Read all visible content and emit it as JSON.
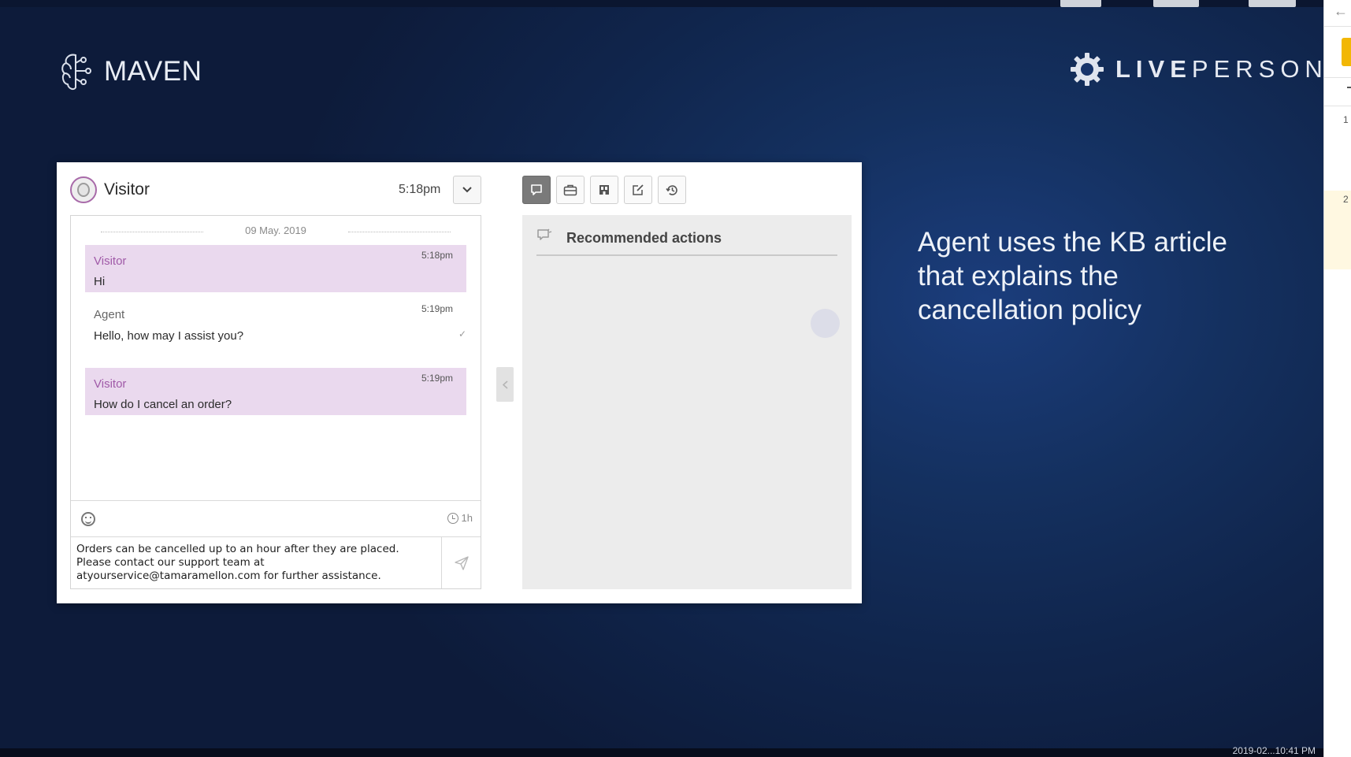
{
  "slide": {
    "brand_left": "MAVEN",
    "brand_right_bold": "LIVE",
    "brand_right_rest": "PERSON",
    "caption": "Agent uses the KB article that explains the cancellation policy",
    "bottom_timestamp": "2019-02...10:41 PM"
  },
  "right_panel": {
    "row_numbers": [
      "1",
      "2"
    ]
  },
  "chat": {
    "header": {
      "visitor_name": "Visitor",
      "time": "5:18pm"
    },
    "date": "09 May. 2019",
    "messages": [
      {
        "sender": "Visitor",
        "time": "5:18pm",
        "text": "Hi"
      },
      {
        "sender": "Agent",
        "time": "5:19pm",
        "text": "Hello, how may I assist you?",
        "status": "✓"
      },
      {
        "sender": "Visitor",
        "time": "5:19pm",
        "text": "How do I cancel an order?"
      }
    ],
    "timer": "1h",
    "composer_text": "Orders can be cancelled up to an hour after they are placed. Please contact our support team at atyourservice@tamaramellon.com for further assistance."
  },
  "toolbar": {
    "buttons": [
      "chat-icon",
      "briefcase-icon",
      "store-icon",
      "edit-icon",
      "history-icon"
    ],
    "active": "chat-icon"
  },
  "recommendations": {
    "title": "Recommended actions"
  },
  "colors": {
    "visitor_bubble": "#ead9ee",
    "visitor_name": "#a05aa8",
    "background": "#10254c"
  }
}
